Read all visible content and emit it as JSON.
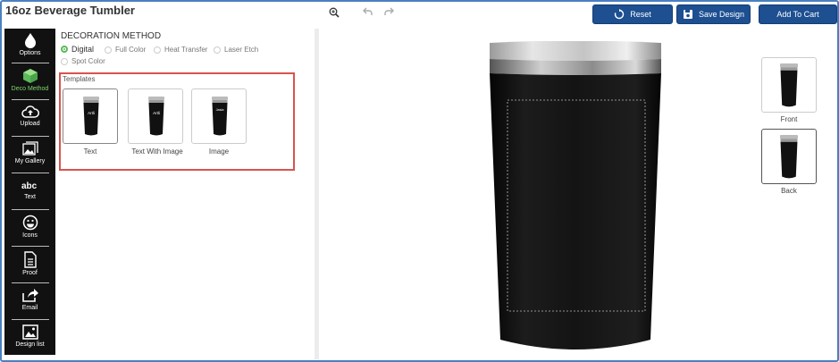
{
  "header": {
    "title": "16oz Beverage Tumbler",
    "reset_label": "Reset",
    "save_label": "Save Design",
    "cart_label": "Add To Cart"
  },
  "sidebar": {
    "items": [
      {
        "label": "Options",
        "icon": "drop-icon"
      },
      {
        "label": "Deco Method",
        "icon": "cube-icon",
        "active": true
      },
      {
        "label": "Upload",
        "icon": "cloud-upload-icon"
      },
      {
        "label": "My Gallery",
        "icon": "gallery-icon"
      },
      {
        "label": "Text",
        "icon": "abc-text-icon"
      },
      {
        "label": "Icons",
        "icon": "smiley-icon"
      },
      {
        "label": "Proof",
        "icon": "document-icon"
      },
      {
        "label": "Email",
        "icon": "share-icon"
      },
      {
        "label": "Design list",
        "icon": "image-list-icon"
      }
    ]
  },
  "decoration": {
    "heading": "DECORATION METHOD",
    "options": [
      "Digital",
      "Full Color",
      "Heat Transfer",
      "Laser Etch",
      "Spot Color"
    ],
    "selected": "Digital"
  },
  "templates": {
    "heading": "Templates",
    "items": [
      {
        "name": "Text",
        "mark": "Artli"
      },
      {
        "name": "Text With Image",
        "mark": "Artli"
      },
      {
        "name": "Image",
        "mark": "Jasia"
      }
    ]
  },
  "views": {
    "front_label": "Front",
    "back_label": "Back",
    "selected": "Back"
  },
  "colors": {
    "accent": "#1d4f91",
    "active_sidebar": "#7dd66b",
    "highlight_border": "#d9534f",
    "product": "#111111"
  }
}
